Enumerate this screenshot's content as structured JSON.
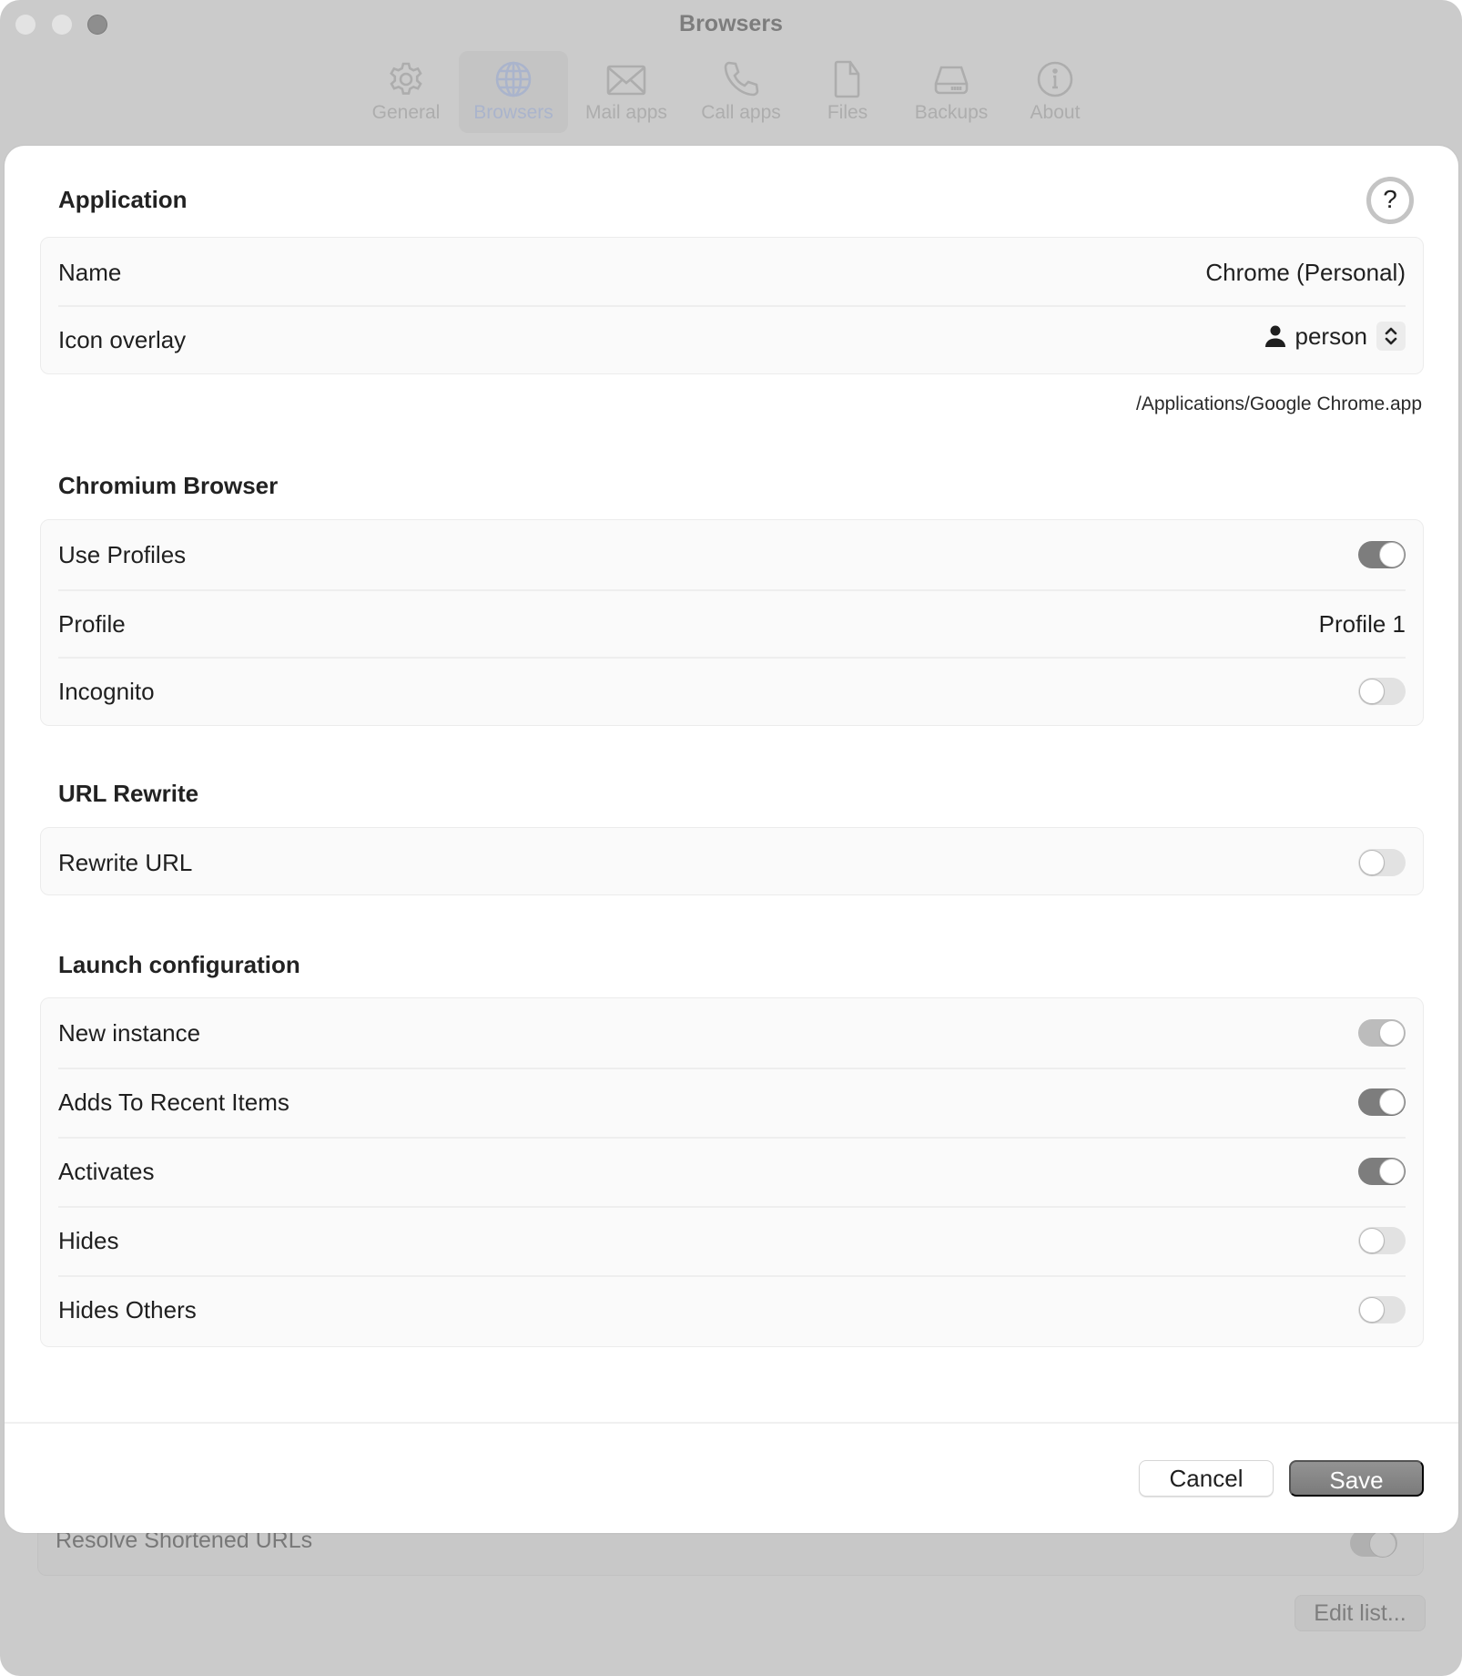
{
  "window": {
    "title": "Browsers",
    "tabs": [
      {
        "label": "General",
        "icon": "gear-icon",
        "active": false
      },
      {
        "label": "Browsers",
        "icon": "globe-icon",
        "active": true
      },
      {
        "label": "Mail apps",
        "icon": "envelope-icon",
        "active": false
      },
      {
        "label": "Call apps",
        "icon": "phone-icon",
        "active": false
      },
      {
        "label": "Files",
        "icon": "document-icon",
        "active": false
      },
      {
        "label": "Backups",
        "icon": "drive-icon",
        "active": false
      },
      {
        "label": "About",
        "icon": "info-icon",
        "active": false
      }
    ],
    "background_row": {
      "label": "Resolve Shortened URLs",
      "on": true
    },
    "edit_list_label": "Edit list..."
  },
  "sheet": {
    "help_label": "?",
    "application": {
      "title": "Application",
      "name_label": "Name",
      "name_value": "Chrome (Personal)",
      "icon_overlay_label": "Icon overlay",
      "icon_overlay_value": "person",
      "app_path": "/Applications/Google Chrome.app"
    },
    "chromium": {
      "title": "Chromium Browser",
      "use_profiles_label": "Use Profiles",
      "use_profiles_on": true,
      "profile_label": "Profile",
      "profile_value": "Profile 1",
      "incognito_label": "Incognito",
      "incognito_on": false
    },
    "url_rewrite": {
      "title": "URL Rewrite",
      "rewrite_label": "Rewrite URL",
      "rewrite_on": false
    },
    "launch": {
      "title": "Launch configuration",
      "items": [
        {
          "label": "New instance",
          "on": true,
          "disabled": true
        },
        {
          "label": "Adds To Recent Items",
          "on": true,
          "disabled": false
        },
        {
          "label": "Activates",
          "on": true,
          "disabled": false
        },
        {
          "label": "Hides",
          "on": false,
          "disabled": false
        },
        {
          "label": "Hides Others",
          "on": false,
          "disabled": false
        }
      ]
    },
    "footer": {
      "cancel_label": "Cancel",
      "save_label": "Save"
    }
  },
  "colors": {
    "toggle_on": "#7d7d7d",
    "toggle_off": "#e2e2e2",
    "toggle_disabled_on": "#bcbcbc",
    "active_tab": "#aab4cc",
    "save_button": "#848484"
  }
}
